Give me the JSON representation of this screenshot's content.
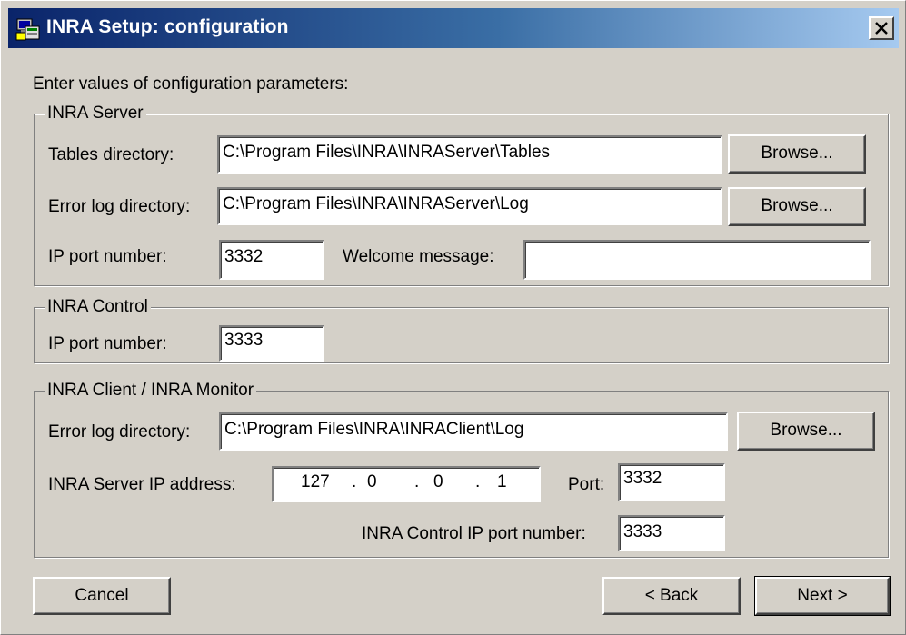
{
  "window": {
    "title": "INRA Setup: configuration"
  },
  "intro": "Enter values of configuration parameters:",
  "server": {
    "legend": "INRA Server",
    "tables_label": "Tables directory:",
    "tables_value": "C:\\Program Files\\INRA\\INRAServer\\Tables",
    "errorlog_label": "Error log directory:",
    "errorlog_value": "C:\\Program Files\\INRA\\INRAServer\\Log",
    "port_label": "IP port number:",
    "port_value": "3332",
    "welcome_label": "Welcome message:",
    "welcome_value": ""
  },
  "control": {
    "legend": "INRA Control",
    "port_label": "IP port number:",
    "port_value": "3333"
  },
  "client": {
    "legend": "INRA Client / INRA Monitor",
    "errorlog_label": "Error log directory:",
    "errorlog_value": "C:\\Program Files\\INRA\\INRAClient\\Log",
    "ip_label": "INRA Server IP address:",
    "ip_octets": [
      "127",
      "0",
      "0",
      "1"
    ],
    "ip_dot": ".",
    "port_label": "Port:",
    "port_value": "3332",
    "control_port_label": "INRA Control IP port number:",
    "control_port_value": "3333"
  },
  "buttons": {
    "browse": "Browse...",
    "cancel": "Cancel",
    "back": "< Back",
    "next": "Next >"
  },
  "icons": {
    "app": "setup-computer-icon",
    "close": "close-icon"
  },
  "colors": {
    "titlebar_start": "#0a246a",
    "titlebar_end": "#a6caf0",
    "face": "#d4d0c8"
  }
}
